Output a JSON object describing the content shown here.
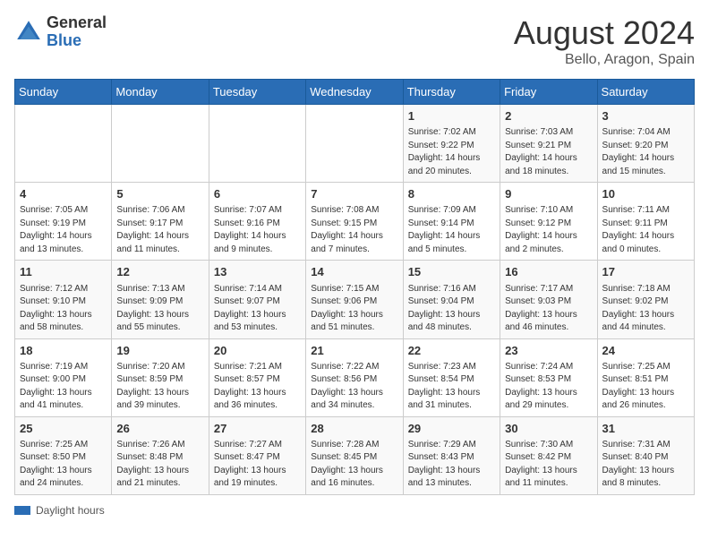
{
  "header": {
    "logo_general": "General",
    "logo_blue": "Blue",
    "month_year": "August 2024",
    "location": "Bello, Aragon, Spain"
  },
  "days_of_week": [
    "Sunday",
    "Monday",
    "Tuesday",
    "Wednesday",
    "Thursday",
    "Friday",
    "Saturday"
  ],
  "footer": {
    "label": "Daylight hours"
  },
  "weeks": [
    [
      {
        "day": "",
        "info": ""
      },
      {
        "day": "",
        "info": ""
      },
      {
        "day": "",
        "info": ""
      },
      {
        "day": "",
        "info": ""
      },
      {
        "day": "1",
        "info": "Sunrise: 7:02 AM\nSunset: 9:22 PM\nDaylight: 14 hours\nand 20 minutes."
      },
      {
        "day": "2",
        "info": "Sunrise: 7:03 AM\nSunset: 9:21 PM\nDaylight: 14 hours\nand 18 minutes."
      },
      {
        "day": "3",
        "info": "Sunrise: 7:04 AM\nSunset: 9:20 PM\nDaylight: 14 hours\nand 15 minutes."
      }
    ],
    [
      {
        "day": "4",
        "info": "Sunrise: 7:05 AM\nSunset: 9:19 PM\nDaylight: 14 hours\nand 13 minutes."
      },
      {
        "day": "5",
        "info": "Sunrise: 7:06 AM\nSunset: 9:17 PM\nDaylight: 14 hours\nand 11 minutes."
      },
      {
        "day": "6",
        "info": "Sunrise: 7:07 AM\nSunset: 9:16 PM\nDaylight: 14 hours\nand 9 minutes."
      },
      {
        "day": "7",
        "info": "Sunrise: 7:08 AM\nSunset: 9:15 PM\nDaylight: 14 hours\nand 7 minutes."
      },
      {
        "day": "8",
        "info": "Sunrise: 7:09 AM\nSunset: 9:14 PM\nDaylight: 14 hours\nand 5 minutes."
      },
      {
        "day": "9",
        "info": "Sunrise: 7:10 AM\nSunset: 9:12 PM\nDaylight: 14 hours\nand 2 minutes."
      },
      {
        "day": "10",
        "info": "Sunrise: 7:11 AM\nSunset: 9:11 PM\nDaylight: 14 hours\nand 0 minutes."
      }
    ],
    [
      {
        "day": "11",
        "info": "Sunrise: 7:12 AM\nSunset: 9:10 PM\nDaylight: 13 hours\nand 58 minutes."
      },
      {
        "day": "12",
        "info": "Sunrise: 7:13 AM\nSunset: 9:09 PM\nDaylight: 13 hours\nand 55 minutes."
      },
      {
        "day": "13",
        "info": "Sunrise: 7:14 AM\nSunset: 9:07 PM\nDaylight: 13 hours\nand 53 minutes."
      },
      {
        "day": "14",
        "info": "Sunrise: 7:15 AM\nSunset: 9:06 PM\nDaylight: 13 hours\nand 51 minutes."
      },
      {
        "day": "15",
        "info": "Sunrise: 7:16 AM\nSunset: 9:04 PM\nDaylight: 13 hours\nand 48 minutes."
      },
      {
        "day": "16",
        "info": "Sunrise: 7:17 AM\nSunset: 9:03 PM\nDaylight: 13 hours\nand 46 minutes."
      },
      {
        "day": "17",
        "info": "Sunrise: 7:18 AM\nSunset: 9:02 PM\nDaylight: 13 hours\nand 44 minutes."
      }
    ],
    [
      {
        "day": "18",
        "info": "Sunrise: 7:19 AM\nSunset: 9:00 PM\nDaylight: 13 hours\nand 41 minutes."
      },
      {
        "day": "19",
        "info": "Sunrise: 7:20 AM\nSunset: 8:59 PM\nDaylight: 13 hours\nand 39 minutes."
      },
      {
        "day": "20",
        "info": "Sunrise: 7:21 AM\nSunset: 8:57 PM\nDaylight: 13 hours\nand 36 minutes."
      },
      {
        "day": "21",
        "info": "Sunrise: 7:22 AM\nSunset: 8:56 PM\nDaylight: 13 hours\nand 34 minutes."
      },
      {
        "day": "22",
        "info": "Sunrise: 7:23 AM\nSunset: 8:54 PM\nDaylight: 13 hours\nand 31 minutes."
      },
      {
        "day": "23",
        "info": "Sunrise: 7:24 AM\nSunset: 8:53 PM\nDaylight: 13 hours\nand 29 minutes."
      },
      {
        "day": "24",
        "info": "Sunrise: 7:25 AM\nSunset: 8:51 PM\nDaylight: 13 hours\nand 26 minutes."
      }
    ],
    [
      {
        "day": "25",
        "info": "Sunrise: 7:25 AM\nSunset: 8:50 PM\nDaylight: 13 hours\nand 24 minutes."
      },
      {
        "day": "26",
        "info": "Sunrise: 7:26 AM\nSunset: 8:48 PM\nDaylight: 13 hours\nand 21 minutes."
      },
      {
        "day": "27",
        "info": "Sunrise: 7:27 AM\nSunset: 8:47 PM\nDaylight: 13 hours\nand 19 minutes."
      },
      {
        "day": "28",
        "info": "Sunrise: 7:28 AM\nSunset: 8:45 PM\nDaylight: 13 hours\nand 16 minutes."
      },
      {
        "day": "29",
        "info": "Sunrise: 7:29 AM\nSunset: 8:43 PM\nDaylight: 13 hours\nand 13 minutes."
      },
      {
        "day": "30",
        "info": "Sunrise: 7:30 AM\nSunset: 8:42 PM\nDaylight: 13 hours\nand 11 minutes."
      },
      {
        "day": "31",
        "info": "Sunrise: 7:31 AM\nSunset: 8:40 PM\nDaylight: 13 hours\nand 8 minutes."
      }
    ]
  ]
}
